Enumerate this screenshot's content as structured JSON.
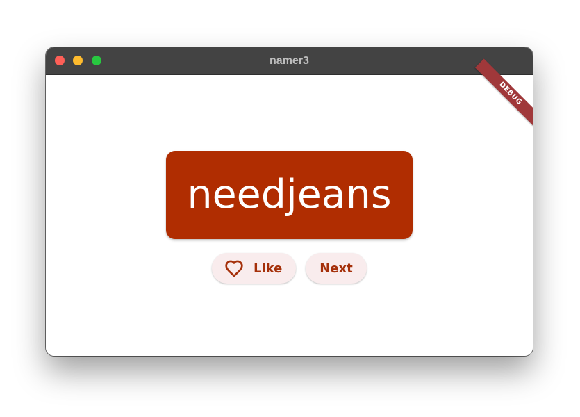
{
  "window": {
    "title": "namer3"
  },
  "debug_banner": {
    "label": "DEBUG"
  },
  "main": {
    "word_pair": "needjeans",
    "like_button": {
      "label": "Like",
      "icon": "heart-outline-icon"
    },
    "next_button": {
      "label": "Next"
    }
  },
  "colors": {
    "card_background": "#b02d01",
    "button_background": "#f9eced",
    "button_text": "#a5300a",
    "titlebar": "#434343",
    "debug_banner": "#a0383a"
  }
}
